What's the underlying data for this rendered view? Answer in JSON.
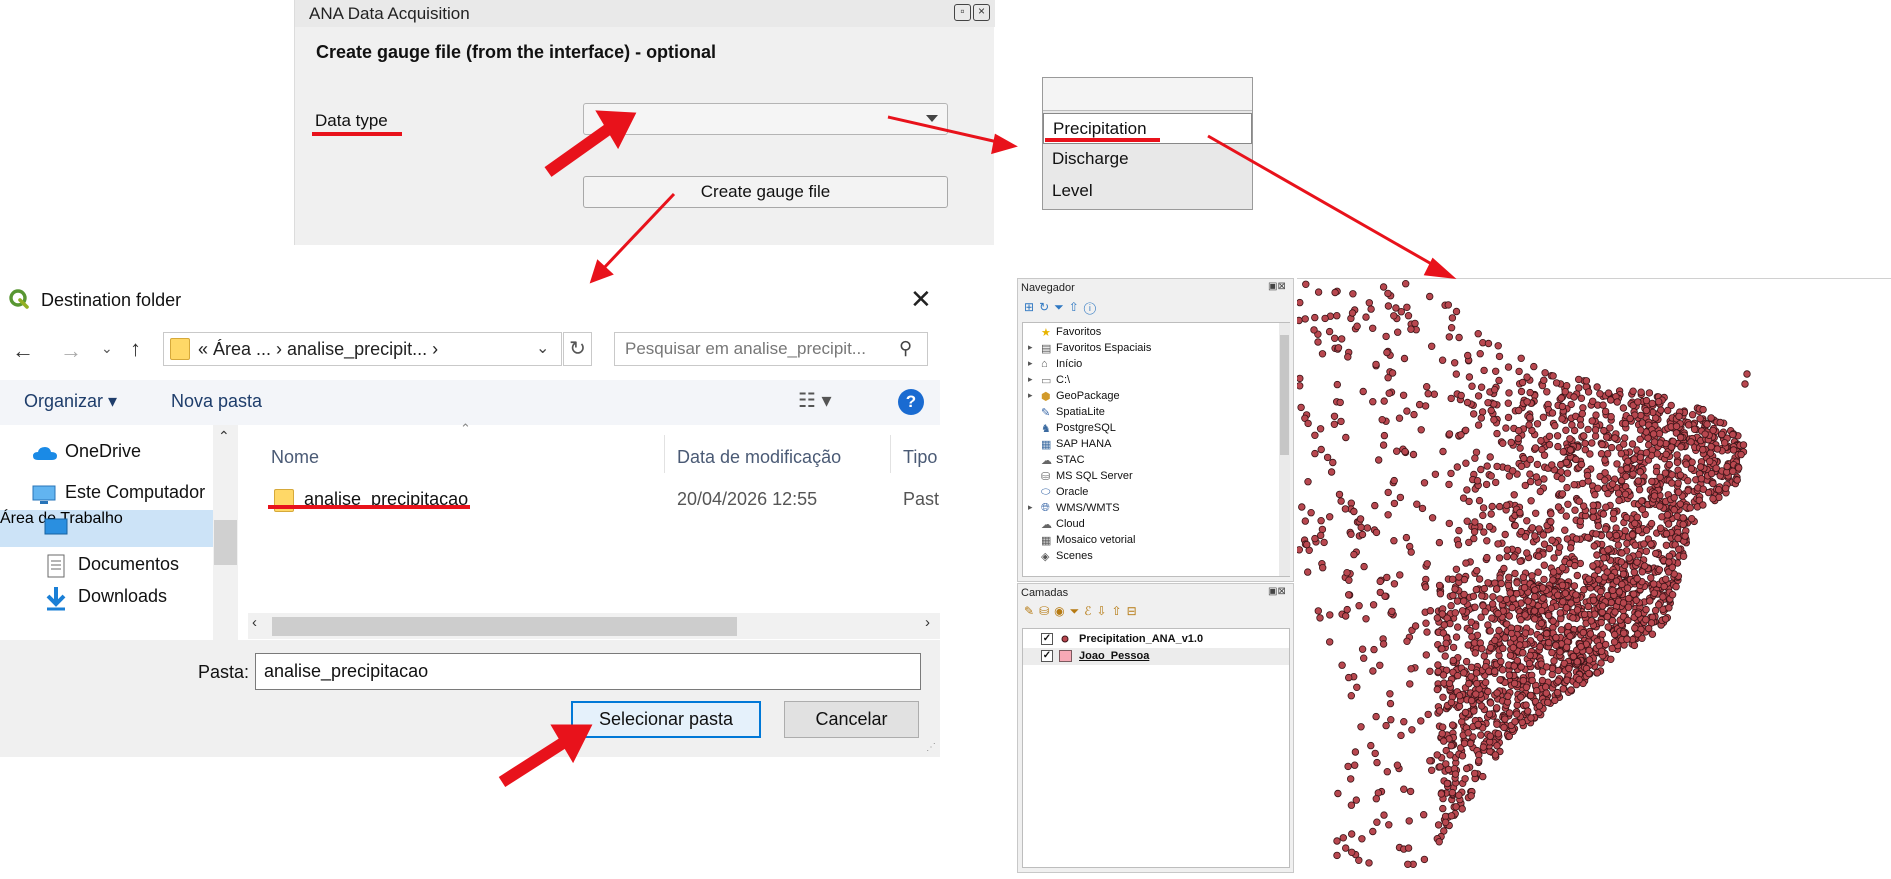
{
  "ana_panel": {
    "title": "ANA Data Acquisition",
    "section_title": "Create gauge file (from the interface) - optional",
    "data_type_label": "Data type",
    "data_type_value": "",
    "create_button": "Create gauge file"
  },
  "dropdown": {
    "items": [
      "Precipitation",
      "Discharge",
      "Level"
    ]
  },
  "dialog": {
    "title": "Destination folder",
    "address_path": "« Área ...  ›  analise_precipit...  ›",
    "search_placeholder": "Pesquisar em analise_precipit...",
    "toolbar": {
      "organizar": "Organizar ▾",
      "nova_pasta": "Nova pasta"
    },
    "nav_items": [
      "OneDrive",
      "Este Computador",
      "Área de Trabalho",
      "Documentos",
      "Downloads"
    ],
    "columns": {
      "name": "Nome",
      "date": "Data de modificação",
      "type": "Tipo"
    },
    "files": [
      {
        "name": "analise_precipitacao",
        "date": "20/04/2026 12:55",
        "type": "Past"
      }
    ],
    "folder_label": "Pasta:",
    "folder_value": "analise_precipitacao",
    "select_button": "Selecionar pasta",
    "cancel_button": "Cancelar"
  },
  "qgis": {
    "browser_title": "Navegador",
    "browser_items": [
      "Favoritos",
      "Favoritos Espaciais",
      "Início",
      "C:\\",
      "GeoPackage",
      "SpatiaLite",
      "PostgreSQL",
      "SAP HANA",
      "STAC",
      "MS SQL Server",
      "Oracle",
      "WMS/WMTS",
      "Cloud",
      "Mosaico vetorial",
      "Scenes"
    ],
    "layers_title": "Camadas",
    "layers": [
      "Precipitation_ANA_v1.0",
      "Joao_Pessoa"
    ]
  },
  "colors": {
    "annotation_red": "#e8121b",
    "point_fill": "#b8474f",
    "point_stroke": "#3b1417",
    "accent_blue": "#0078d7"
  }
}
